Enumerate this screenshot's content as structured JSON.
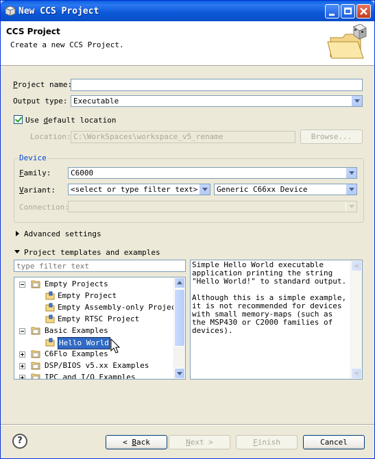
{
  "window": {
    "title": "New CCS Project"
  },
  "header": {
    "title": "CCS Project",
    "subtitle": "Create a new CCS Project."
  },
  "form": {
    "project_name": {
      "label_pre": "",
      "label_key": "P",
      "label_post": "roject name:",
      "value": ""
    },
    "output_type": {
      "label": "Output type:",
      "value": "Executable"
    },
    "use_default": {
      "label_pre": "Use ",
      "label_key": "d",
      "label_post": "efault location",
      "checked": true
    },
    "location": {
      "label": "Location:",
      "value": "C:\\WorkSpaces\\workspace_v5_rename",
      "browse": "Browse..."
    }
  },
  "device": {
    "title": "Device",
    "family": {
      "label_key": "F",
      "label_post": "amily:",
      "value": "C6000"
    },
    "variant": {
      "label_key": "V",
      "label_post": "ariant:",
      "filter": "<select or type filter text>",
      "value": "Generic C66xx Device"
    },
    "connection": {
      "label": "Connection:",
      "value": ""
    }
  },
  "advanced": {
    "label": "Advanced settings"
  },
  "templates": {
    "label": "Project templates and examples",
    "filter_placeholder": "type filter text",
    "tree": [
      {
        "label": "Empty Projects",
        "level": 0,
        "toggle": "minus"
      },
      {
        "label": "Empty Project",
        "level": 1
      },
      {
        "label": "Empty Assembly-only Project",
        "level": 1
      },
      {
        "label": "Empty RTSC Project",
        "level": 1
      },
      {
        "label": "Basic Examples",
        "level": 0,
        "toggle": "minus"
      },
      {
        "label": "Hello World",
        "level": 1,
        "selected": true
      },
      {
        "label": "C6Flo Examples",
        "level": 0,
        "toggle": "plus"
      },
      {
        "label": "DSP/BIOS v5.xx Examples",
        "level": 0,
        "toggle": "plus"
      },
      {
        "label": "IPC and I/O Examples",
        "level": 0,
        "toggle": "plus"
      }
    ],
    "description": "Simple Hello World executable application printing the string \"Hello World!\" to standard output.\n\nAlthough this is a simple example, it is not recommended for devices with small memory-maps (such as the MSP430 or C2000 families of devices)."
  },
  "buttons": {
    "back_pre": "< ",
    "back_key": "B",
    "back_post": "ack",
    "next_key": "N",
    "next_post": "ext >",
    "finish_key": "F",
    "finish_post": "inish",
    "cancel": "Cancel",
    "help": "?"
  }
}
